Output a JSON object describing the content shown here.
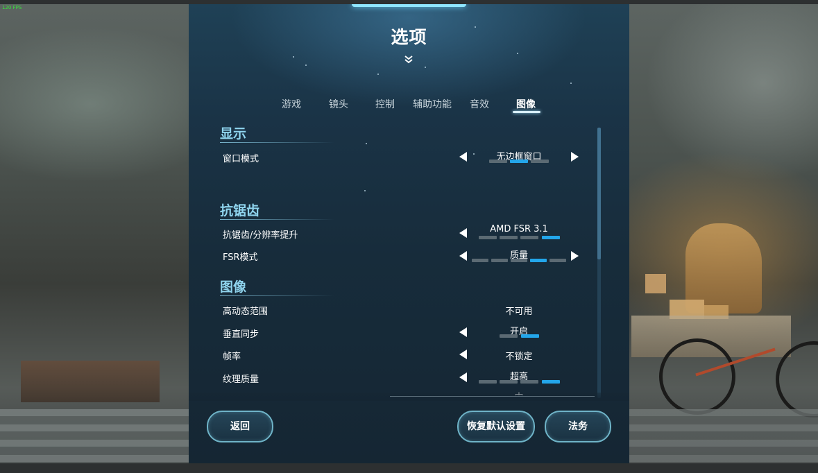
{
  "hud": {
    "fps": "120 FPS"
  },
  "header": {
    "title": "选项"
  },
  "tabs": [
    {
      "label": "游戏"
    },
    {
      "label": "镜头"
    },
    {
      "label": "控制"
    },
    {
      "label": "辅助功能"
    },
    {
      "label": "音效"
    },
    {
      "label": "图像",
      "active": true
    }
  ],
  "sections": {
    "display": {
      "title": "显示",
      "rows": {
        "window_mode": {
          "label": "窗口模式",
          "value": "无边框窗口",
          "option_index": 2,
          "option_count": 3
        }
      }
    },
    "antialiasing": {
      "title": "抗锯齿",
      "rows": {
        "upscaling": {
          "label": "抗锯齿/分辨率提升",
          "value": "AMD FSR 3.1",
          "option_index": 4,
          "option_count": 4
        },
        "fsr_mode": {
          "label": "FSR模式",
          "value": "质量",
          "option_index": 4,
          "option_count": 5
        }
      }
    },
    "image": {
      "title": "图像",
      "rows": {
        "hdr": {
          "label": "高动态范围",
          "value": "不可用"
        },
        "vsync": {
          "label": "垂直同步",
          "value": "开启",
          "option_index": 2,
          "option_count": 2
        },
        "framerate": {
          "label": "帧率",
          "value": "不锁定"
        },
        "texture_quality": {
          "label": "纹理质量",
          "value": "超高",
          "option_index": 4,
          "option_count": 4
        },
        "next_row_value": "中"
      }
    }
  },
  "footer": {
    "back_label": "返回",
    "reset_label": "恢复默认设置",
    "legal_label": "法务"
  },
  "colors": {
    "accent": "#23a6ea",
    "section_title": "#8fd4ee",
    "button_border": "#6fb4c8"
  }
}
